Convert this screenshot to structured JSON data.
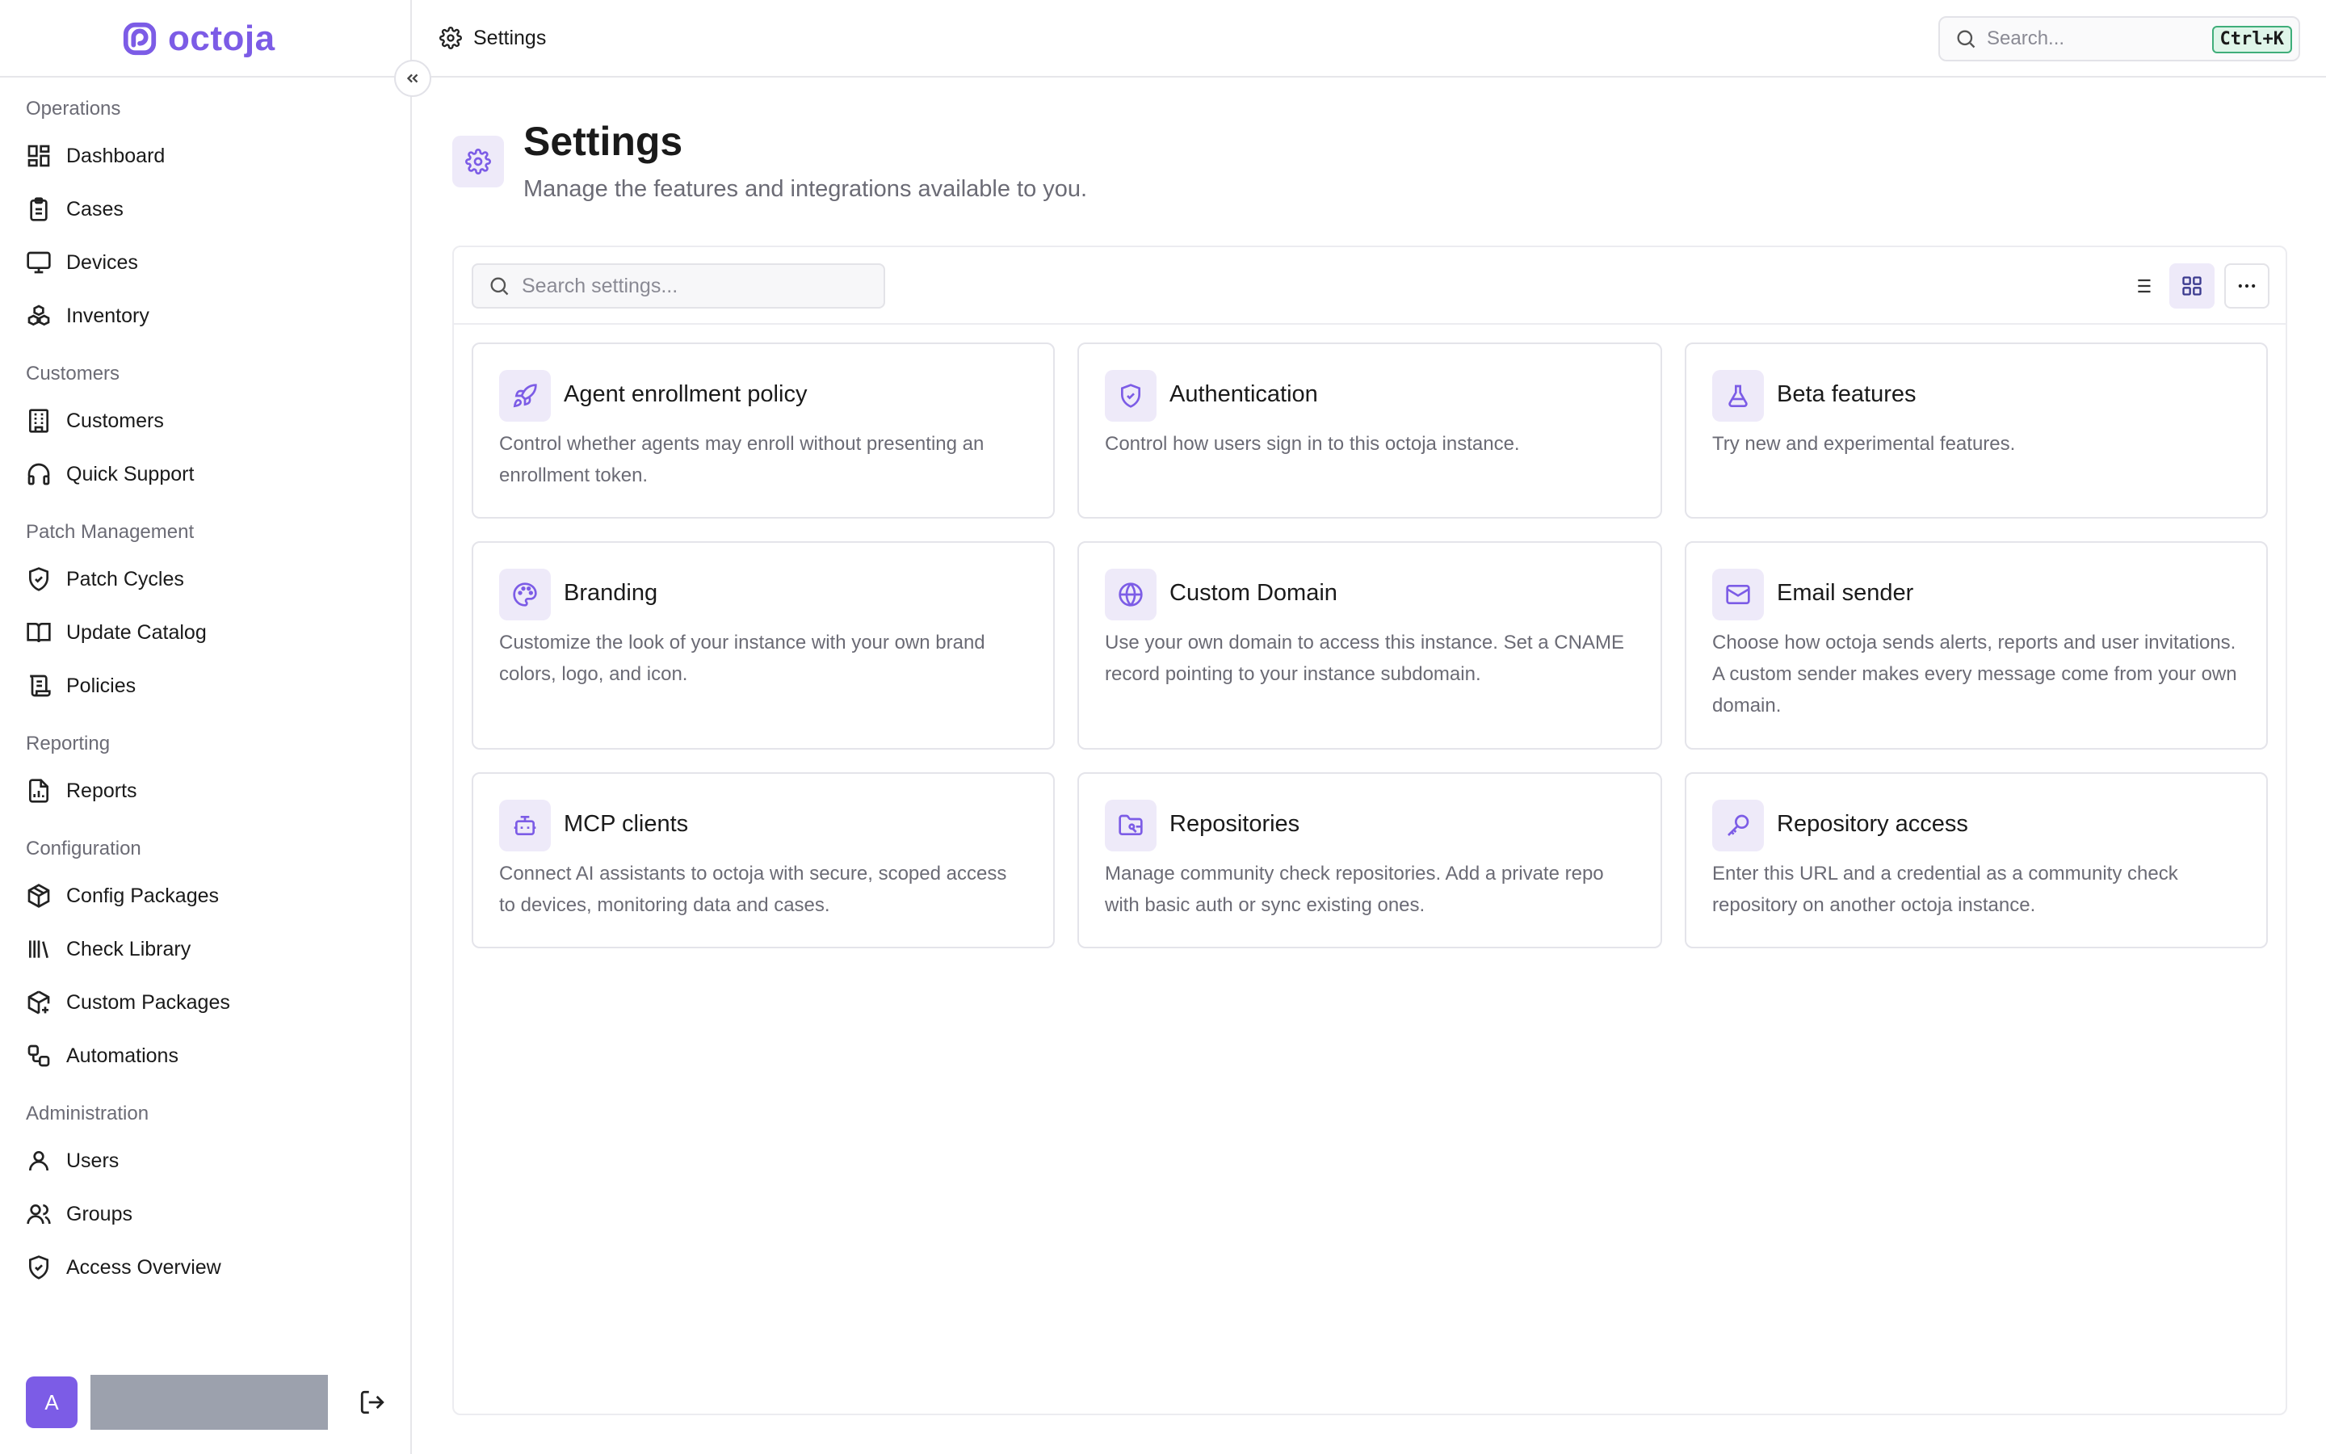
{
  "brand": {
    "name": "octoja",
    "color": "#7c5ce6"
  },
  "sidebar": {
    "sections": [
      {
        "title": "Operations",
        "items": [
          {
            "label": "Dashboard",
            "icon": "dashboard-icon"
          },
          {
            "label": "Cases",
            "icon": "clipboard-icon"
          },
          {
            "label": "Devices",
            "icon": "monitor-icon"
          },
          {
            "label": "Inventory",
            "icon": "boxes-icon"
          }
        ]
      },
      {
        "title": "Customers",
        "items": [
          {
            "label": "Customers",
            "icon": "building-icon"
          },
          {
            "label": "Quick Support",
            "icon": "headset-icon"
          }
        ]
      },
      {
        "title": "Patch Management",
        "items": [
          {
            "label": "Patch Cycles",
            "icon": "shield-check-icon"
          },
          {
            "label": "Update Catalog",
            "icon": "book-open-icon"
          },
          {
            "label": "Policies",
            "icon": "scroll-icon"
          }
        ]
      },
      {
        "title": "Reporting",
        "items": [
          {
            "label": "Reports",
            "icon": "report-icon"
          }
        ]
      },
      {
        "title": "Configuration",
        "items": [
          {
            "label": "Config Packages",
            "icon": "package-icon"
          },
          {
            "label": "Check Library",
            "icon": "library-icon"
          },
          {
            "label": "Custom Packages",
            "icon": "package-plus-icon"
          },
          {
            "label": "Automations",
            "icon": "workflow-icon"
          }
        ]
      },
      {
        "title": "Administration",
        "items": [
          {
            "label": "Users",
            "icon": "user-icon"
          },
          {
            "label": "Groups",
            "icon": "users-icon"
          },
          {
            "label": "Access Overview",
            "icon": "shield-icon"
          }
        ]
      }
    ],
    "user": {
      "initial": "A"
    }
  },
  "topbar": {
    "breadcrumb": "Settings",
    "search_placeholder": "Search...",
    "shortcut": "Ctrl+K"
  },
  "page": {
    "title": "Settings",
    "subtitle": "Manage the features and integrations available to you.",
    "search_placeholder": "Search settings..."
  },
  "cards": [
    {
      "title": "Agent enrollment policy",
      "desc": "Control whether agents may enroll without presenting an enrollment token.",
      "icon": "rocket-icon"
    },
    {
      "title": "Authentication",
      "desc": "Control how users sign in to this octoja instance.",
      "icon": "shield-check-icon"
    },
    {
      "title": "Beta features",
      "desc": "Try new and experimental features.",
      "icon": "flask-icon"
    },
    {
      "title": "Branding",
      "desc": "Customize the look of your instance with your own brand colors, logo, and icon.",
      "icon": "palette-icon"
    },
    {
      "title": "Custom Domain",
      "desc": "Use your own domain to access this instance. Set a CNAME record pointing to your instance subdomain.",
      "icon": "globe-icon"
    },
    {
      "title": "Email sender",
      "desc": "Choose how octoja sends alerts, reports and user invitations. A custom sender makes every message come from your own domain.",
      "icon": "mail-icon"
    },
    {
      "title": "MCP clients",
      "desc": "Connect AI assistants to octoja with secure, scoped access to devices, monitoring data and cases.",
      "icon": "bot-icon"
    },
    {
      "title": "Repositories",
      "desc": "Manage community check repositories. Add a private repo with basic auth or sync existing ones.",
      "icon": "folder-git-icon"
    },
    {
      "title": "Repository access",
      "desc": "Enter this URL and a credential as a community check repository on another octoja instance.",
      "icon": "key-icon"
    }
  ]
}
